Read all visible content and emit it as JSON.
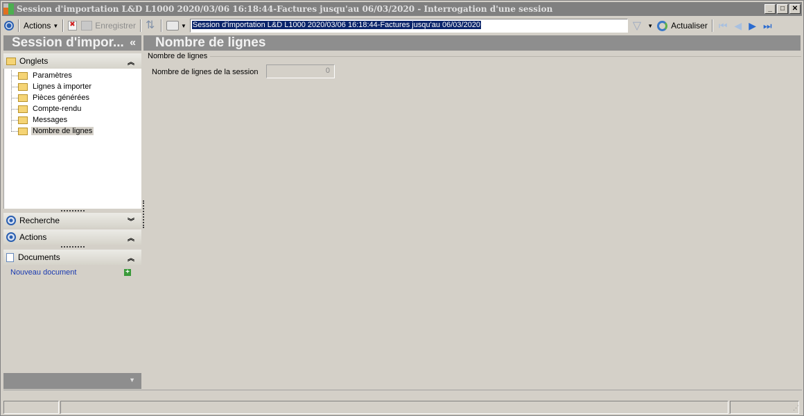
{
  "window": {
    "title": "Session d'importation L&D L1000 2020/03/06 16:18:44-Factures jusqu'au 06/03/2020 -  Interrogation d'une session",
    "minimize": "_",
    "maximize": "□",
    "close": "✕"
  },
  "toolbar": {
    "actions_label": "Actions",
    "save_label": "Enregistrer",
    "session_value": "Session d'importation L&D L1000 2020/03/06 16:18:44-Factures jusqu'au 06/03/2020",
    "refresh_label": "Actualiser"
  },
  "left_pane": {
    "header": "Session d'impor...",
    "collapse": "«",
    "tabs_section": {
      "title": "Onglets",
      "items": [
        {
          "label": "Paramètres"
        },
        {
          "label": "Lignes à importer"
        },
        {
          "label": "Pièces générées"
        },
        {
          "label": "Compte-rendu"
        },
        {
          "label": "Messages"
        },
        {
          "label": "Nombre de lignes"
        }
      ],
      "selected_index": 5
    },
    "search_section": {
      "title": "Recherche"
    },
    "actions_section": {
      "title": "Actions"
    },
    "documents_section": {
      "title": "Documents",
      "new_document": "Nouveau document"
    }
  },
  "main": {
    "header": "Nombre de lignes",
    "group_title": "Nombre de lignes",
    "field_label": "Nombre de lignes de la session",
    "field_value": "0"
  },
  "colors": {
    "header_bg": "#8e8e8e",
    "window_bg": "#d4d0c8",
    "selection": "#0a246a",
    "link": "#1a3ab0"
  }
}
